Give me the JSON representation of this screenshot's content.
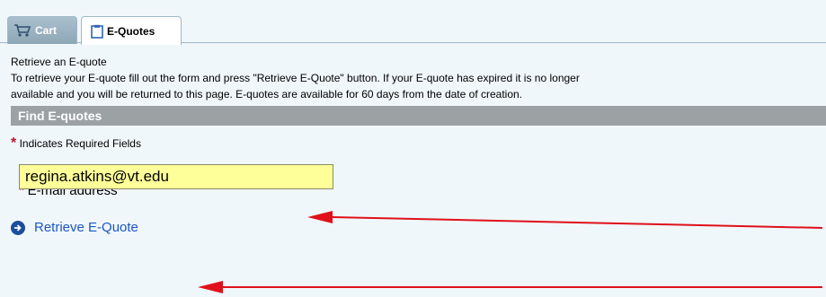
{
  "tabs": [
    {
      "label": "Cart",
      "icon": "cart-icon",
      "active": false
    },
    {
      "label": "E-Quotes",
      "icon": "clipboard-icon",
      "active": true
    }
  ],
  "intro": {
    "heading": "Retrieve an E-quote",
    "line1": "To retrieve your E-quote fill out the form and press \"Retrieve E-Quote\" button. If your E-quote has expired it is no longer",
    "line2": "available and you will be returned to this page. E-quotes are available for 60 days from the date of creation."
  },
  "section": {
    "title": "Find E-quotes"
  },
  "required_note": {
    "star": "*",
    "text": "Indicates Required Fields"
  },
  "email": {
    "star": "*",
    "label": "E-mail address",
    "value": "regina.atkins@vt.edu"
  },
  "retrieve_link": {
    "label": "Retrieve E-Quote",
    "icon": "arrow-circle-icon"
  },
  "colors": {
    "accent_link": "#1c55c6",
    "required": "#c0152a",
    "annotation": "#e0101a",
    "input_bg": "#ffff99",
    "section_bar": "#9ca1a4"
  }
}
